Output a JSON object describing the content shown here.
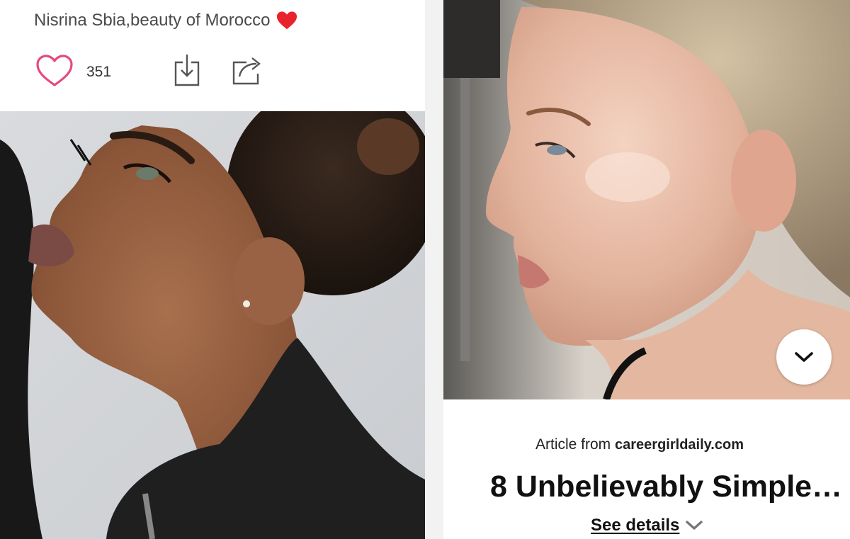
{
  "left_pin": {
    "title": "Nisrina Sbia,beauty of Morocco",
    "title_emoji": "red-heart-icon",
    "like_count": "351",
    "icons": {
      "like": "heart-outline-icon",
      "save": "download-icon",
      "share": "share-icon"
    },
    "photo": "woman-profile-looking-up-photo"
  },
  "right_pin": {
    "photo": "woman-side-profile-photo",
    "expand_icon": "chevron-down-icon",
    "article_prefix": "Article from",
    "article_source": "careergirldaily.com",
    "title": "8 Unbelievably Simple…",
    "see_details": "See details"
  },
  "colors": {
    "heart": "#e64a7a",
    "emoji_heart": "#e8232e",
    "text": "#4a4a4a",
    "accent_dark": "#111111"
  }
}
